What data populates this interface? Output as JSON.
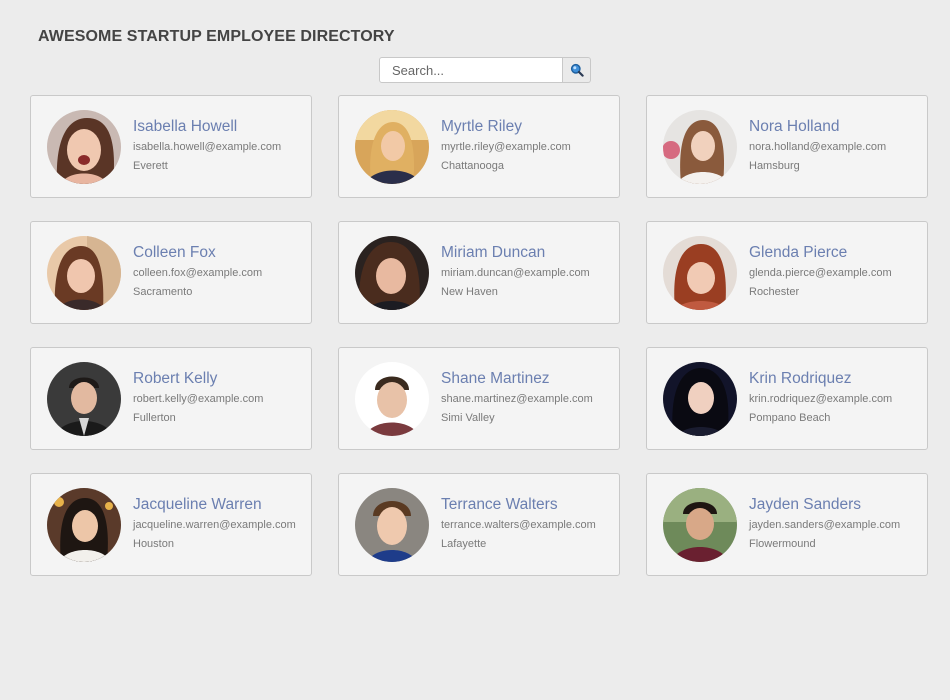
{
  "header": {
    "title": "AWESOME STARTUP EMPLOYEE DIRECTORY"
  },
  "search": {
    "placeholder": "Search...",
    "value": ""
  },
  "colors": {
    "name": "#6b7fb0",
    "card_bg": "#f4f4f4",
    "card_border": "#c9c9c9",
    "page_bg": "#ececec"
  },
  "employees": [
    {
      "name": "Isabella Howell",
      "email": "isabella.howell@example.com",
      "city": "Everett",
      "avatar_icon": "user-photo-icon"
    },
    {
      "name": "Myrtle Riley",
      "email": "myrtle.riley@example.com",
      "city": "Chattanooga",
      "avatar_icon": "user-photo-icon"
    },
    {
      "name": "Nora Holland",
      "email": "nora.holland@example.com",
      "city": "Hamsburg",
      "avatar_icon": "user-photo-icon"
    },
    {
      "name": "Colleen Fox",
      "email": "colleen.fox@example.com",
      "city": "Sacramento",
      "avatar_icon": "user-photo-icon"
    },
    {
      "name": "Miriam Duncan",
      "email": "miriam.duncan@example.com",
      "city": "New Haven",
      "avatar_icon": "user-photo-icon"
    },
    {
      "name": "Glenda Pierce",
      "email": "glenda.pierce@example.com",
      "city": "Rochester",
      "avatar_icon": "user-photo-icon"
    },
    {
      "name": "Robert Kelly",
      "email": "robert.kelly@example.com",
      "city": "Fullerton",
      "avatar_icon": "user-photo-icon"
    },
    {
      "name": "Shane Martinez",
      "email": "shane.martinez@example.com",
      "city": "Simi Valley",
      "avatar_icon": "user-photo-icon"
    },
    {
      "name": "Krin Rodriquez",
      "email": "krin.rodriquez@example.com",
      "city": "Pompano Beach",
      "avatar_icon": "user-photo-icon"
    },
    {
      "name": "Jacqueline Warren",
      "email": "jacqueline.warren@example.com",
      "city": "Houston",
      "avatar_icon": "user-photo-icon"
    },
    {
      "name": "Terrance Walters",
      "email": "terrance.walters@example.com",
      "city": "Lafayette",
      "avatar_icon": "user-photo-icon"
    },
    {
      "name": "Jayden Sanders",
      "email": "jayden.sanders@example.com",
      "city": "Flowermound",
      "avatar_icon": "user-photo-icon"
    }
  ]
}
